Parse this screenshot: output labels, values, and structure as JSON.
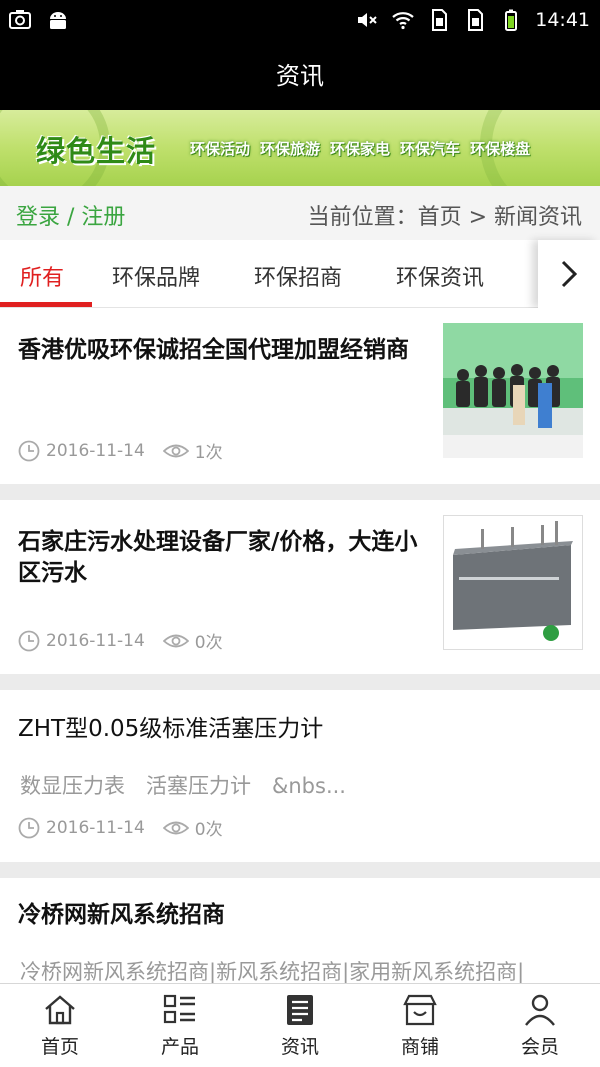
{
  "status_bar": {
    "time": "14:41"
  },
  "header": {
    "title": "资讯"
  },
  "banner": {
    "title": "绿色生活",
    "items": [
      "环保活动",
      "环保旅游",
      "环保家电",
      "环保汽车",
      "环保楼盘"
    ]
  },
  "location": {
    "login_link": "登录 / 注册",
    "breadcrumb": "当前位置：首页 > 新闻资讯"
  },
  "tabs": [
    {
      "label": "所有",
      "active": true
    },
    {
      "label": "环保品牌"
    },
    {
      "label": "环保招商"
    },
    {
      "label": "环保资讯"
    }
  ],
  "news": [
    {
      "title": "香港优吸环保诚招全国代理加盟经销商",
      "date": "2016-11-14",
      "views": "1次"
    },
    {
      "title": "石家庄污水处理设备厂家/价格，大连小区污水",
      "date": "2016-11-14",
      "views": "0次"
    },
    {
      "title": "ZHT型0.05级标准活塞压力计",
      "desc": "数显压力表　活塞压力计　&nbs...",
      "date": "2016-11-14",
      "views": "0次"
    },
    {
      "title": "冷桥网新风系统招商",
      "desc": "冷桥网新风系统招商|新风系统招商|家用新风系统招商|"
    }
  ],
  "bottom_nav": [
    {
      "label": "首页",
      "icon": "home-icon"
    },
    {
      "label": "产品",
      "icon": "list-icon"
    },
    {
      "label": "资讯",
      "icon": "news-icon"
    },
    {
      "label": "商铺",
      "icon": "shop-icon"
    },
    {
      "label": "会员",
      "icon": "user-icon"
    }
  ],
  "colors": {
    "accent_red": "#e02020",
    "accent_green": "#3aa540",
    "header_bg": "#000000"
  }
}
